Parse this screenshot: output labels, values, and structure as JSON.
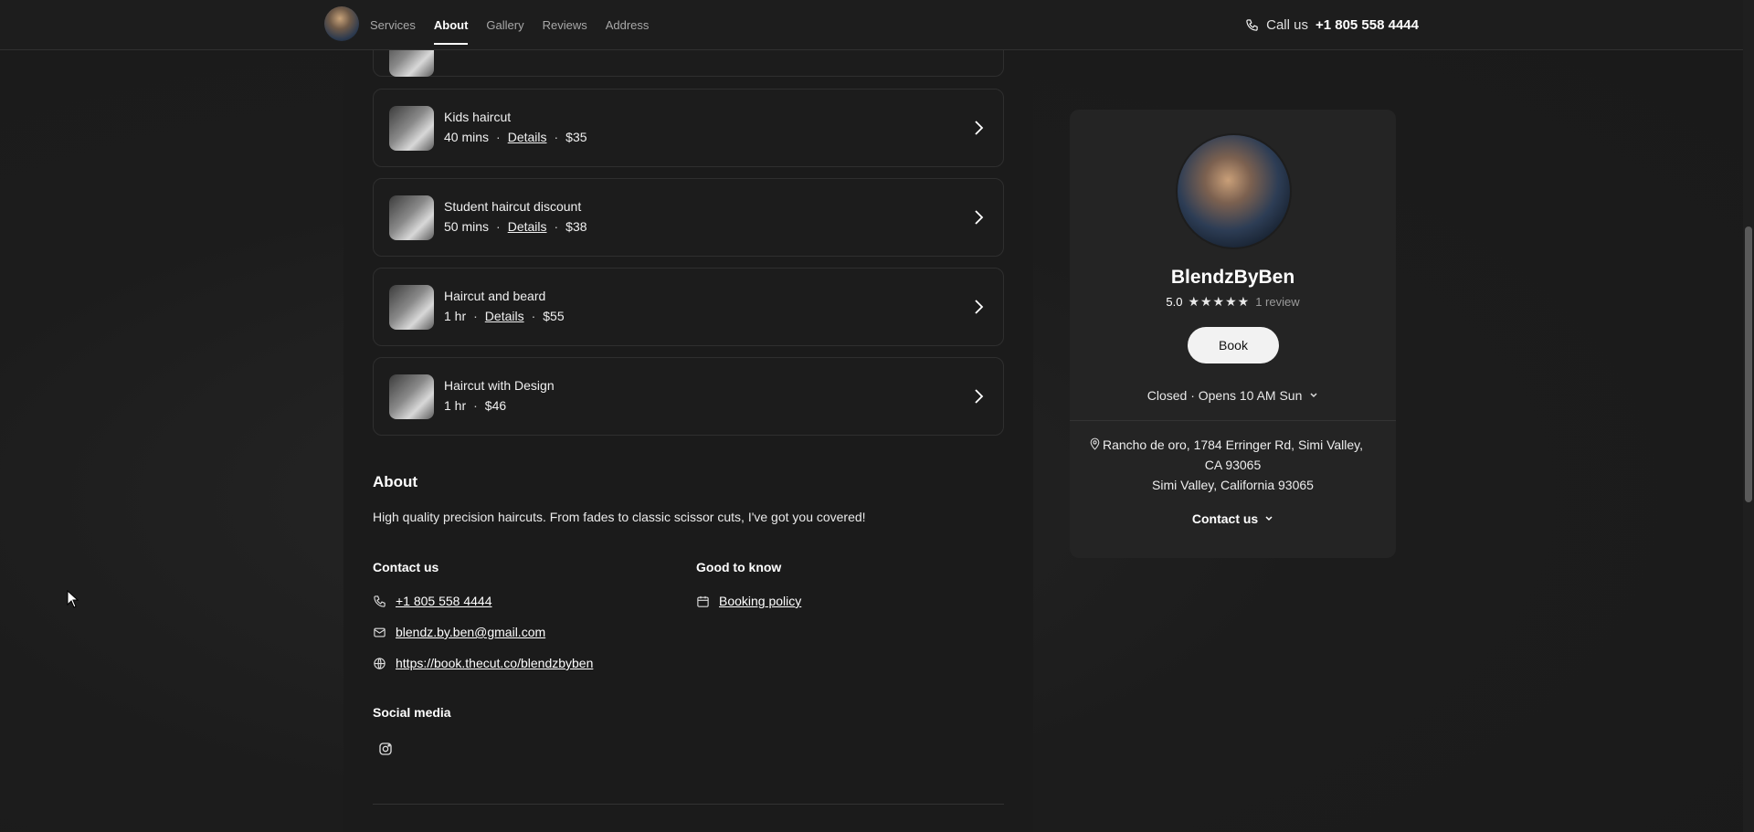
{
  "nav": {
    "links": [
      "Services",
      "About",
      "Gallery",
      "Reviews",
      "Address"
    ],
    "call_label": "Call us",
    "call_number": "+1 805 558 4444"
  },
  "services": [
    {
      "name": "Kids haircut",
      "duration": "40 mins",
      "details": "Details",
      "price": "$35"
    },
    {
      "name": "Student haircut discount",
      "duration": "50 mins",
      "details": "Details",
      "price": "$38"
    },
    {
      "name": "Haircut and beard",
      "duration": "1 hr",
      "details": "Details",
      "price": "$55"
    },
    {
      "name": "Haircut with Design",
      "duration": "1 hr",
      "details": "",
      "price": "$46"
    }
  ],
  "about": {
    "heading": "About",
    "text": "High quality precision haircuts. From fades to classic scissor cuts, I've got you covered!",
    "contact_heading": "Contact us",
    "phone": "+1 805 558 4444",
    "email": "blendz.by.ben@gmail.com",
    "website": "https://book.thecut.co/blendzbyben",
    "good_heading": "Good to know",
    "booking_policy": "Booking policy",
    "social_heading": "Social media"
  },
  "card": {
    "name": "BlendzByBen",
    "rating": "5.0",
    "stars": "★★★★★",
    "reviews": "1 review",
    "book_label": "Book",
    "hours": "Closed · Opens 10 AM Sun",
    "address_line1": "Rancho de oro, 1784 Erringer Rd, Simi Valley,",
    "address_line2": "CA 93065",
    "address_line3": "Simi Valley, California 93065",
    "contact_label": "Contact us"
  }
}
